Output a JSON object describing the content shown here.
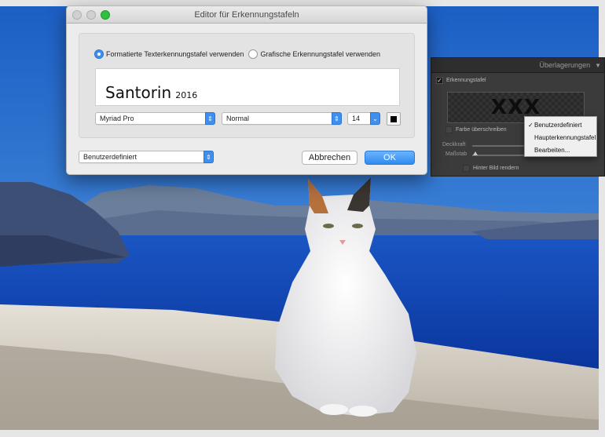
{
  "dialog": {
    "title": "Editor für Erkennungstafeln",
    "radio_styled": "Formatierte Texterkennungstafel verwenden",
    "radio_graphic": "Grafische Erkennungstafel verwenden",
    "plate_text_main": "Santorin",
    "plate_text_year": "2016",
    "font_family": "Myriad Pro",
    "font_style": "Normal",
    "font_size": "14",
    "preset": "Benutzerdefiniert",
    "cancel_label": "Abbrechen",
    "ok_label": "OK"
  },
  "overlay_panel": {
    "header": "Überlagerungen",
    "identity_plate_label": "Erkennungstafel",
    "preview_text": "XXX",
    "override_color_label": "Farbe überschreiben",
    "opacity_label": "Deckkraft",
    "scale_label": "Maßstab",
    "render_behind_label": "Hinter Bild rendern"
  },
  "overlay_menu": {
    "items": [
      "Benutzerdefiniert",
      "Haupterkennungstafel",
      "Bearbeiten..."
    ],
    "selected_index": 0
  },
  "colors": {
    "accent": "#3d8ff2",
    "sky": "#1f66c9",
    "sea": "#0c3fa8"
  }
}
